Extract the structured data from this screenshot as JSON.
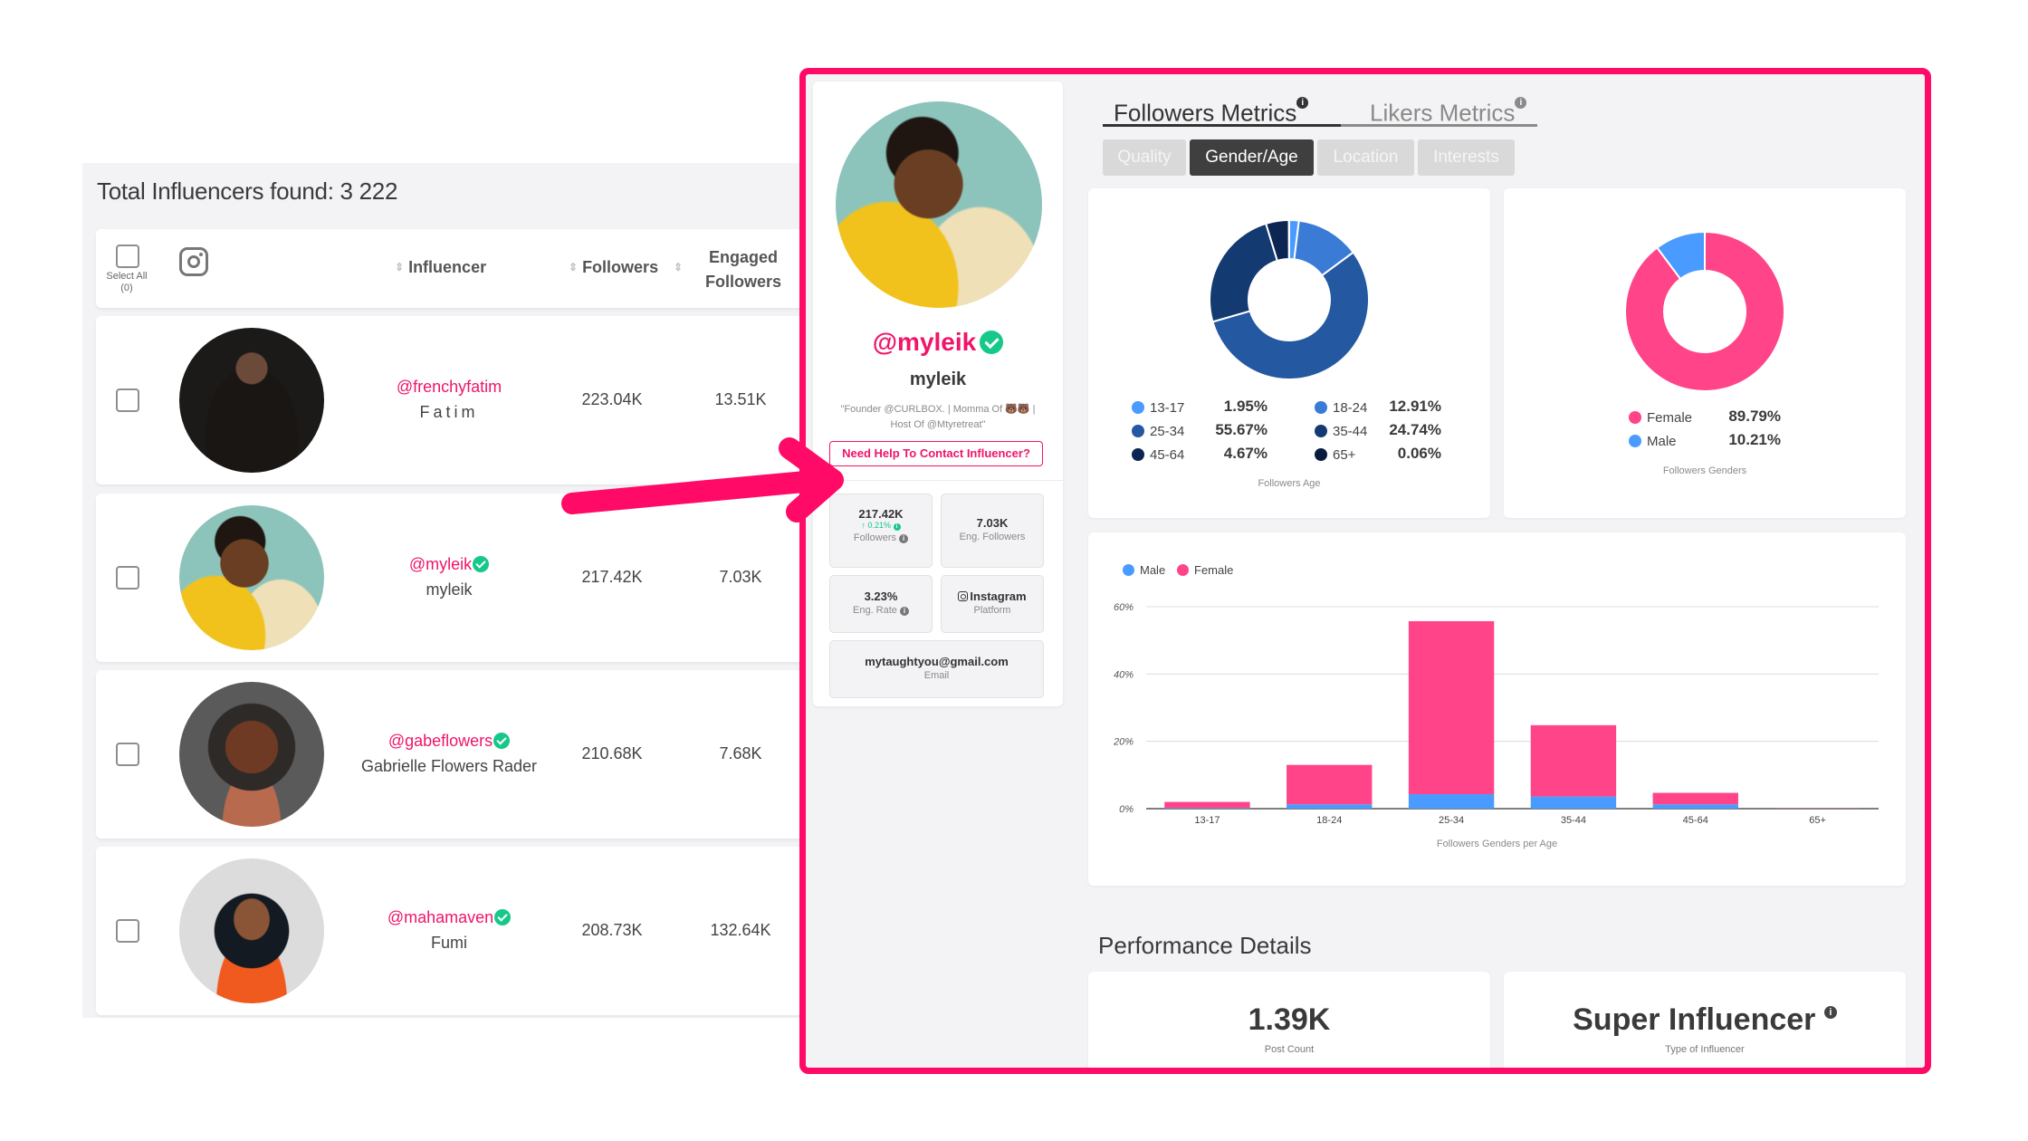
{
  "list": {
    "total_label": "Total Influencers found: 3 222",
    "header": {
      "select_all": "Select All",
      "select_count": "(0)",
      "platform_icon": "instagram-icon",
      "col_influencer": "Influencer",
      "col_followers": "Followers",
      "col_engaged_line1": "Engaged",
      "col_engaged_line2": "Followers"
    },
    "rows": [
      {
        "handle": "@frenchyfatim",
        "name": "Fatim",
        "verified": false,
        "followers": "223.04K",
        "engaged": "13.51K"
      },
      {
        "handle": "@myleik",
        "name": "myleik",
        "verified": true,
        "followers": "217.42K",
        "engaged": "7.03K"
      },
      {
        "handle": "@gabeflowers",
        "name": "Gabrielle Flowers Rader",
        "verified": true,
        "followers": "210.68K",
        "engaged": "7.68K"
      },
      {
        "handle": "@mahamaven",
        "name": "Fumi",
        "verified": true,
        "followers": "208.73K",
        "engaged": "132.64K"
      }
    ]
  },
  "profile": {
    "handle": "@myleik",
    "name": "myleik",
    "bio_line1": "\"Founder @CURLBOX. | Momma Of 🐻🐻 |",
    "bio_line2": "Host Of @Mtyretreat\"",
    "contact_button": "Need Help To Contact Influencer?",
    "stats": {
      "followers_value": "217.42K",
      "followers_growth": "↑ 0.21%",
      "followers_label": "Followers",
      "eng_followers_value": "7.03K",
      "eng_followers_label": "Eng. Followers",
      "eng_rate_value": "3.23%",
      "eng_rate_label": "Eng. Rate",
      "platform_value": "Instagram",
      "platform_label": "Platform",
      "email_value": "mytaughtyou@gmail.com",
      "email_label": "Email"
    }
  },
  "metrics": {
    "tabs": [
      {
        "label": "Followers Metrics",
        "active": true
      },
      {
        "label": "Likers Metrics",
        "active": false
      }
    ],
    "subtabs": [
      {
        "label": "Quality",
        "active": false
      },
      {
        "label": "Gender/Age",
        "active": true
      },
      {
        "label": "Location",
        "active": false
      },
      {
        "label": "Interests",
        "active": false
      }
    ]
  },
  "colors": {
    "brand_pink": "#ff0a66",
    "female": "#ff4489",
    "male": "#4a9bff",
    "verified": "#16c88a",
    "age": [
      "#4a9bff",
      "#3a7bd5",
      "#2458a0",
      "#143a72",
      "#0c2552",
      "#0a1c3e"
    ]
  },
  "chart_data": [
    {
      "type": "pie",
      "title": "Followers Age",
      "labels": [
        "13-17",
        "18-24",
        "25-34",
        "35-44",
        "45-64",
        "65+"
      ],
      "values": [
        1.95,
        12.91,
        55.67,
        24.74,
        4.67,
        0.06
      ],
      "value_labels": [
        "1.95%",
        "12.91%",
        "55.67%",
        "24.74%",
        "4.67%",
        "0.06%"
      ],
      "donut": true,
      "legend": "bottom"
    },
    {
      "type": "pie",
      "title": "Followers Genders",
      "labels": [
        "Female",
        "Male"
      ],
      "values": [
        89.79,
        10.21
      ],
      "value_labels": [
        "89.79%",
        "10.21%"
      ],
      "donut": true,
      "legend": "bottom"
    },
    {
      "type": "bar",
      "stacked": true,
      "title": "Followers Genders per Age",
      "categories": [
        "13-17",
        "18-24",
        "25-34",
        "35-44",
        "45-64",
        "65+"
      ],
      "series": [
        {
          "name": "Male",
          "values": [
            0.2,
            1.3,
            4.3,
            3.6,
            1.3,
            0.0
          ]
        },
        {
          "name": "Female",
          "values": [
            1.8,
            11.7,
            51.4,
            21.2,
            3.4,
            0.06
          ]
        }
      ],
      "yticks": [
        "0%",
        "20%",
        "40%",
        "60%"
      ],
      "ylim": [
        0,
        60
      ],
      "grid": true,
      "legend": "top-left"
    }
  ],
  "performance": {
    "title": "Performance Details",
    "post_count_value": "1.39K",
    "post_count_label": "Post Count",
    "type_value": "Super Influencer",
    "type_label": "Type of Influencer"
  }
}
